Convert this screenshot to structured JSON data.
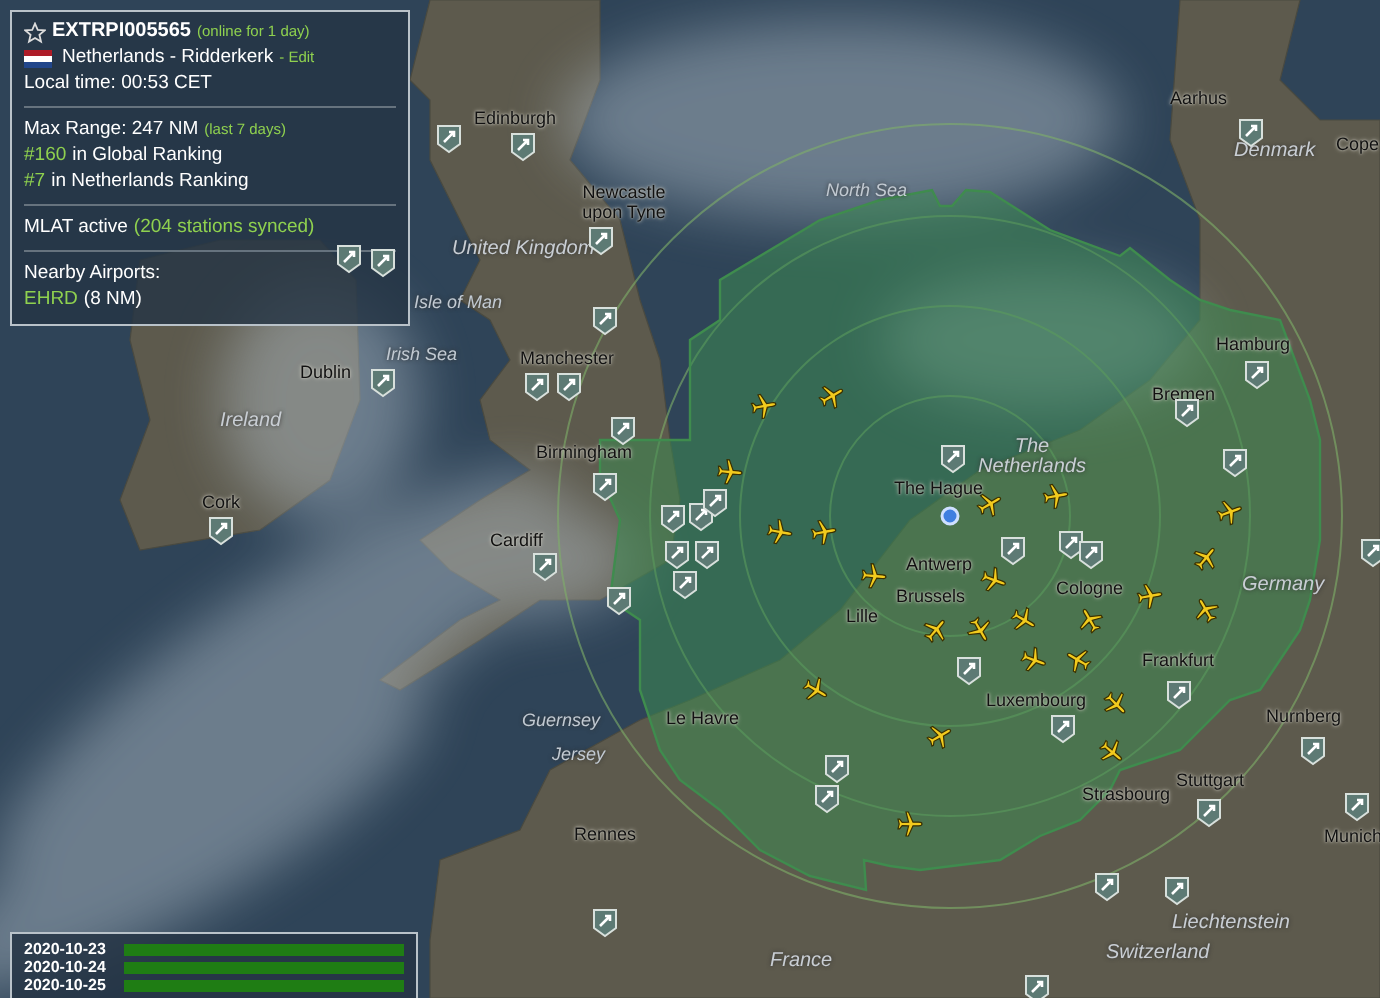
{
  "station_panel": {
    "station_id": "EXTRPI005565",
    "online_note": "(online for 1 day)",
    "location": "Netherlands - Ridderkerk",
    "edit_link": "- Edit",
    "local_time": "Local time: 00:53 CET",
    "max_range": "Max Range: 247 NM",
    "range_period": "(last 7 days)",
    "rankings": [
      {
        "rank": "#160",
        "label": "in Global Ranking"
      },
      {
        "rank": "#7",
        "label": "in Netherlands Ranking"
      }
    ],
    "mlat_status": "MLAT active",
    "mlat_note": "(204 stations synced)",
    "airports_heading": "Nearby Airports:",
    "nearby_airports": [
      {
        "code": "EHRD",
        "distance": "(8 NM)"
      }
    ]
  },
  "uptime": [
    {
      "date": "2020-10-23",
      "level": 1
    },
    {
      "date": "2020-10-24",
      "level": 1
    },
    {
      "date": "2020-10-25",
      "level": 1
    }
  ],
  "map_labels": [
    {
      "text": "Aarhus",
      "kind": "city"
    },
    {
      "text": "Cope",
      "kind": "city"
    },
    {
      "text": "Denmark",
      "kind": "country"
    },
    {
      "text": "Edinburgh",
      "kind": "city"
    },
    {
      "text": "North Sea",
      "kind": "sea"
    },
    {
      "text": "Newcastle upon Tyne",
      "kind": "city"
    },
    {
      "text": "United Kingdom",
      "kind": "country"
    },
    {
      "text": "Isle of Man",
      "kind": "sea"
    },
    {
      "text": "Irish Sea",
      "kind": "sea"
    },
    {
      "text": "Manchester",
      "kind": "city"
    },
    {
      "text": "Ireland",
      "kind": "country"
    },
    {
      "text": "Dublin",
      "kind": "city"
    },
    {
      "text": "Cork",
      "kind": "city"
    },
    {
      "text": "Birmingham",
      "kind": "city"
    },
    {
      "text": "Cardiff",
      "kind": "city"
    },
    {
      "text": "The Hague",
      "kind": "city"
    },
    {
      "text": "The Netherlands",
      "kind": "country"
    },
    {
      "text": "Bremen",
      "kind": "city"
    },
    {
      "text": "Hamburg",
      "kind": "city"
    },
    {
      "text": "Antwerp",
      "kind": "city"
    },
    {
      "text": "Brussels",
      "kind": "city"
    },
    {
      "text": "Lille",
      "kind": "city"
    },
    {
      "text": "Cologne",
      "kind": "city"
    },
    {
      "text": "Germany",
      "kind": "country"
    },
    {
      "text": "Frankfurt",
      "kind": "city"
    },
    {
      "text": "Luxembourg",
      "kind": "city"
    },
    {
      "text": "Le Havre",
      "kind": "city"
    },
    {
      "text": "Nurnberg",
      "kind": "city"
    },
    {
      "text": "Strasbourg",
      "kind": "city"
    },
    {
      "text": "Stuttgart",
      "kind": "city"
    },
    {
      "text": "Munich",
      "kind": "city"
    },
    {
      "text": "Guernsey",
      "kind": "sea"
    },
    {
      "text": "Jersey",
      "kind": "sea"
    },
    {
      "text": "Rennes",
      "kind": "city"
    },
    {
      "text": "France",
      "kind": "country"
    },
    {
      "text": "Liechtenstein",
      "kind": "country"
    },
    {
      "text": "Switzerland",
      "kind": "country"
    }
  ]
}
